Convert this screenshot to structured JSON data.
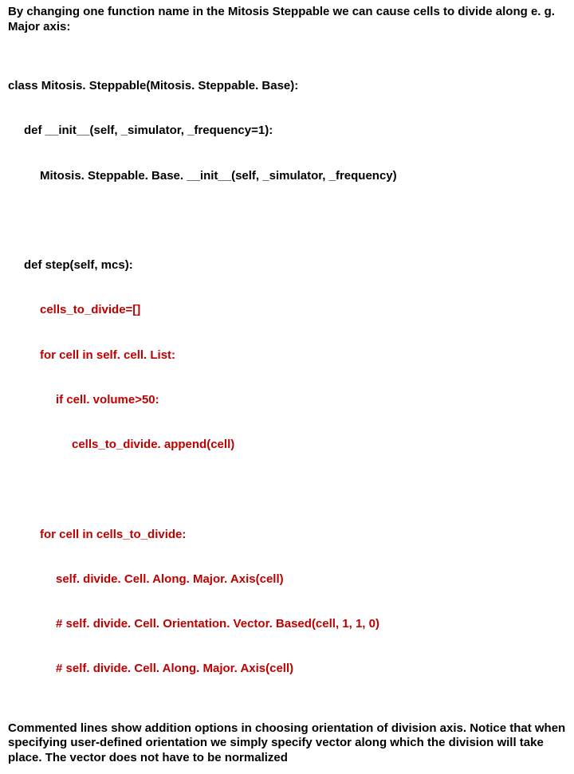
{
  "intro": "By changing one function name in the Mitosis Steppable we can cause cells to divide along e. g. Major axis:",
  "code": {
    "l1a": "class Mitosis. Steppable(",
    "l1b": "Mitosis. Steppable. Base",
    "l1c": "):",
    "l2": "def __init__(self, _simulator, _frequency=1):",
    "l3": "Mitosis. Steppable. Base. __init__(self, _simulator, _frequency)",
    "l4": "def step(self, mcs):",
    "l5": "cells_to_divide=[]",
    "l6": "for cell in self. cell. List:",
    "l7": "if cell. volume>50:",
    "l8": "cells_to_divide. append(cell)",
    "l9": "for cell in cells_to_divide:",
    "l10": "self. divide. Cell. Along. Major. Axis(cell)",
    "l11": "# self. divide. Cell. Orientation. Vector. Based(cell, 1, 1, 0)",
    "l12": "# self. divide. Cell. Along. Major. Axis(cell)"
  },
  "footer": "Commented lines show addition options in choosing orientation of division axis. Notice that when specifying user-defined orientation we simply specify vector along which the division will take place. The vector does not have to be normalized"
}
